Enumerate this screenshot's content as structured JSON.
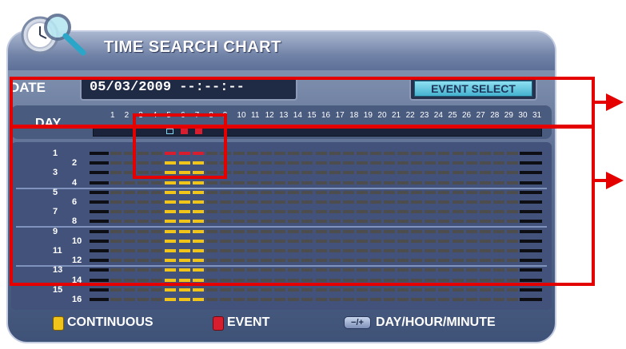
{
  "header": {
    "title": "TIME SEARCH CHART",
    "logo_icon": "clock-magnifier-icon"
  },
  "date": {
    "label": "DATE",
    "value": "05/03/2009 --:--:--"
  },
  "event_select": {
    "label": "EVENT SELECT"
  },
  "day": {
    "label": "DAY",
    "numbers": [
      "1",
      "2",
      "3",
      "4",
      "5",
      "6",
      "7",
      "8",
      "9",
      "10",
      "11",
      "12",
      "13",
      "14",
      "15",
      "16",
      "17",
      "18",
      "19",
      "20",
      "21",
      "22",
      "23",
      "24",
      "25",
      "26",
      "27",
      "28",
      "29",
      "30",
      "31"
    ],
    "selected": "5",
    "event_days": [
      "6",
      "7"
    ]
  },
  "channels": [
    "1",
    "2",
    "3",
    "4",
    "5",
    "6",
    "7",
    "8",
    "9",
    "10",
    "11",
    "12",
    "13",
    "14",
    "15",
    "16"
  ],
  "legend": {
    "continuous": "CONTINUOUS",
    "event": "EVENT",
    "nav_icon": "minus-plus-icon",
    "nav_label": "DAY/HOUR/MINUTE"
  },
  "colors": {
    "continuous": "#f0c419",
    "event": "#d81e2e",
    "empty_cell": "#4d4d4d",
    "highlight": "#e50000",
    "accent": "#45b2cf"
  }
}
